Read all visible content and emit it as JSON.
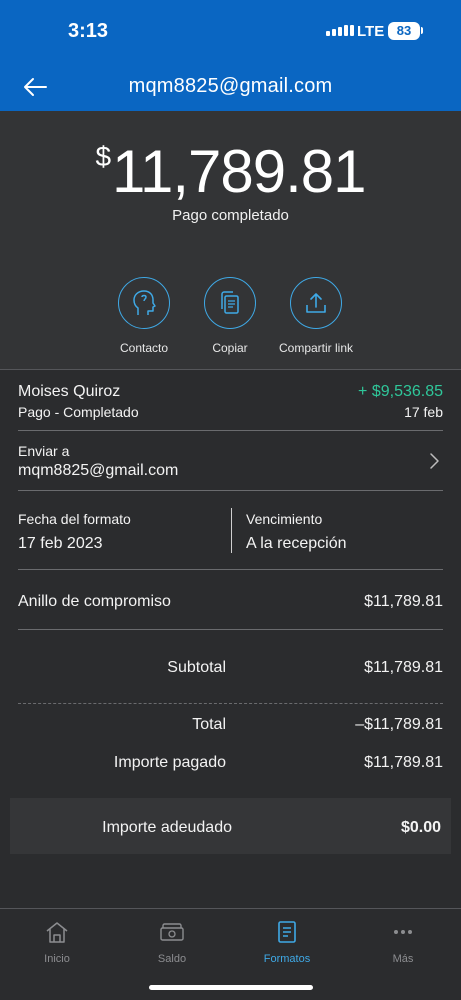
{
  "status_bar": {
    "time": "3:13",
    "network": "LTE",
    "battery": "83"
  },
  "header": {
    "title": "mqm8825@gmail.com",
    "back_icon": "arrow-left-icon"
  },
  "summary": {
    "currency_symbol": "$",
    "amount": "11,789.81",
    "status": "Pago completado"
  },
  "actions": [
    {
      "label": "Contacto",
      "icon": "contact-icon"
    },
    {
      "label": "Copiar",
      "icon": "copy-icon"
    },
    {
      "label": "Compartir link",
      "icon": "share-icon"
    }
  ],
  "payment": {
    "name": "Moises Quiroz",
    "status": "Pago - Completado",
    "amount": "+ $9,536.85",
    "date": "17 feb",
    "amount_color": "#2fc79a"
  },
  "send_to": {
    "label": "Enviar a",
    "email": "mqm8825@gmail.com"
  },
  "dates": {
    "issue_label": "Fecha del formato",
    "issue_value": "17 feb 2023",
    "due_label": "Vencimiento",
    "due_value": "A la recepción"
  },
  "item": {
    "name": "Anillo de compromiso",
    "price": "$11,789.81"
  },
  "totals": {
    "subtotal_label": "Subtotal",
    "subtotal_value": "$11,789.81",
    "total_label": "Total",
    "total_value": "–$11,789.81",
    "paid_label": "Importe pagado",
    "paid_value": "$11,789.81",
    "due_label": "Importe adeudado",
    "due_value": "$0.00"
  },
  "tabs": [
    {
      "label": "Inicio",
      "icon": "home-icon",
      "active": false
    },
    {
      "label": "Saldo",
      "icon": "wallet-icon",
      "active": false
    },
    {
      "label": "Formatos",
      "icon": "invoice-icon",
      "active": true
    },
    {
      "label": "Más",
      "icon": "more-icon",
      "active": false
    }
  ],
  "colors": {
    "brand": "#0a66c2",
    "accent": "#3fa9e6",
    "background": "#2b2c2e"
  }
}
